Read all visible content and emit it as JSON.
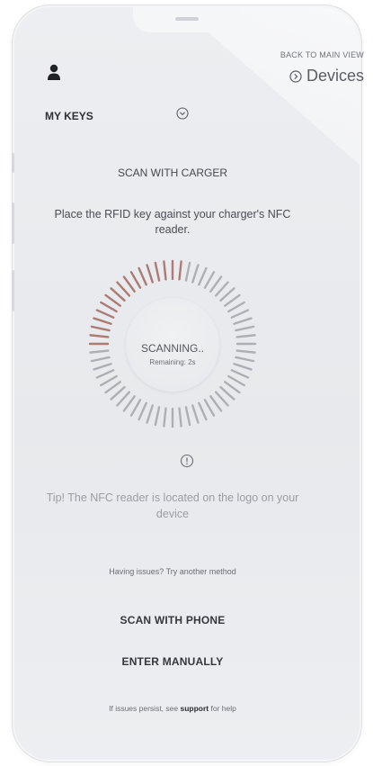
{
  "header": {
    "back_label": "BACK TO MAIN VIEW",
    "devices_label": "Devices",
    "my_keys_label": "MY KEYS"
  },
  "scan": {
    "title": "SCAN WITH CARGER",
    "instruction": "Place the RFID key against your charger's NFC reader.",
    "status": "SCANNING..",
    "remaining": "Remaining: 2s",
    "progress": 0.28
  },
  "tip": {
    "text": "Tip! The NFC reader is located on the logo on your device"
  },
  "alternatives": {
    "prompt": "Having issues? Try another method",
    "scan_phone_label": "SCAN WITH PHONE",
    "enter_manually_label": "ENTER MANUALLY"
  },
  "footer": {
    "prefix": "If issues persist, see",
    "support_link": "support",
    "suffix": "for help"
  },
  "colors": {
    "tick_active": "#a8766e",
    "tick_inactive": "#8f9196",
    "background": "#e9ebee"
  },
  "icons": {
    "user": "person-icon",
    "devices": "chevron-right-circle-icon",
    "dropdown": "chevron-down-circle-icon",
    "info": "info-circle-icon"
  }
}
